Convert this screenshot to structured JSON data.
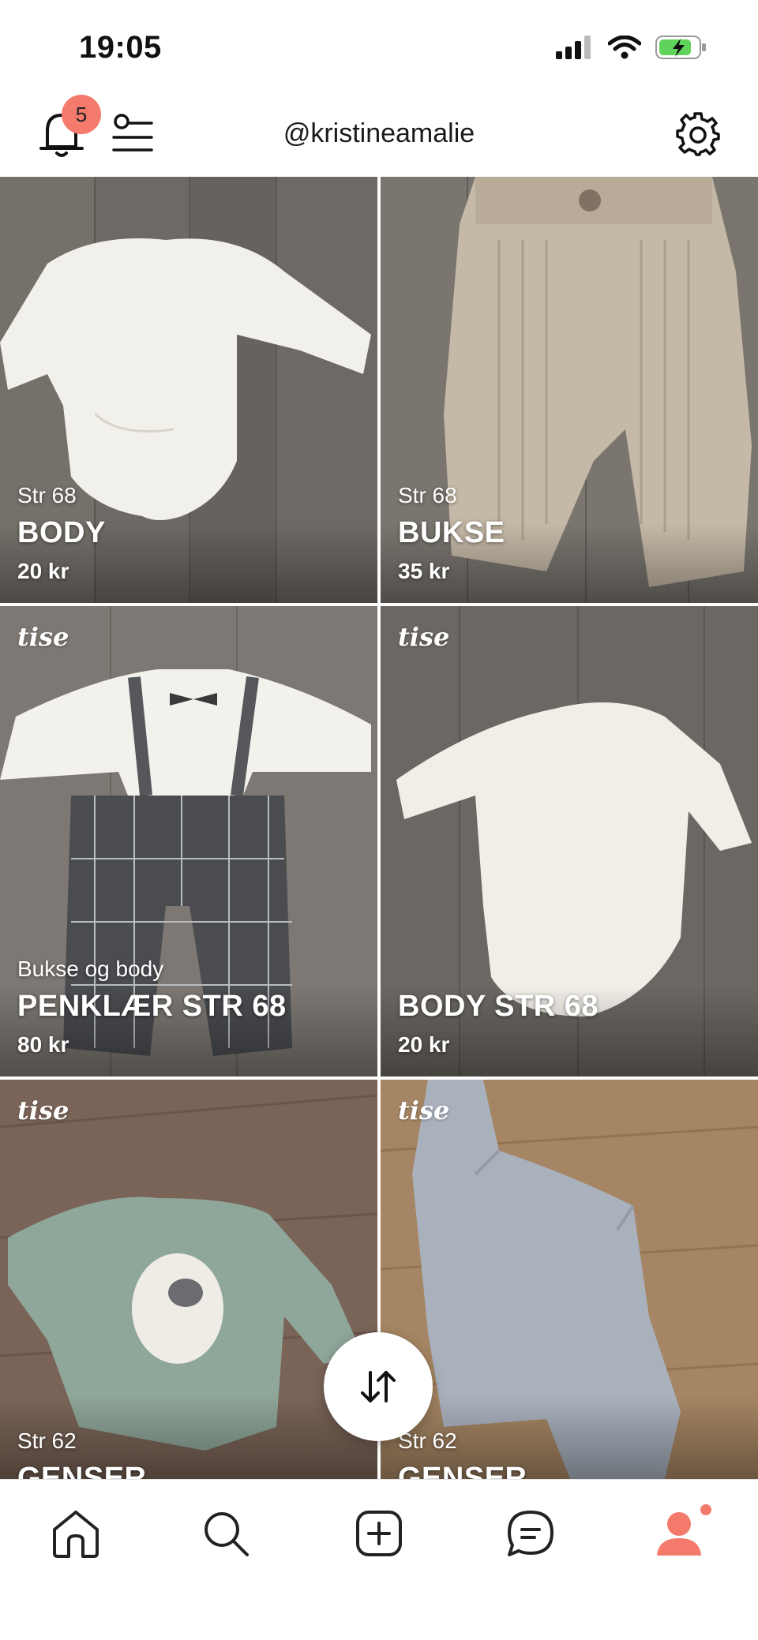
{
  "status_bar": {
    "time": "19:05"
  },
  "header": {
    "username": "@kristineamalie",
    "notification_count": "5"
  },
  "listings": [
    {
      "subtitle": "Str 68",
      "title": "BODY",
      "price": "20 kr",
      "brand_watermark": ""
    },
    {
      "subtitle": "Str 68",
      "title": "BUKSE",
      "price": "35 kr",
      "brand_watermark": ""
    },
    {
      "subtitle": "Bukse og body",
      "title": "PENKLÆR STR 68",
      "price": "80 kr",
      "brand_watermark": "tise"
    },
    {
      "subtitle": "",
      "title": "BODY STR 68",
      "price": "20 kr",
      "brand_watermark": "tise"
    },
    {
      "subtitle": "Str 62",
      "title": "GENSER",
      "price": "",
      "brand_watermark": "tise"
    },
    {
      "subtitle": "Str 62",
      "title": "GENSER",
      "price": "",
      "brand_watermark": "tise"
    }
  ],
  "bottom_nav": {
    "items": [
      "home-icon",
      "search-icon",
      "add-icon",
      "messages-icon",
      "profile-icon"
    ],
    "active": "profile-icon"
  },
  "colors": {
    "accent": "#f47a6c",
    "floor_dark": "#6f6a66",
    "floor_light": "#9a8f84"
  }
}
